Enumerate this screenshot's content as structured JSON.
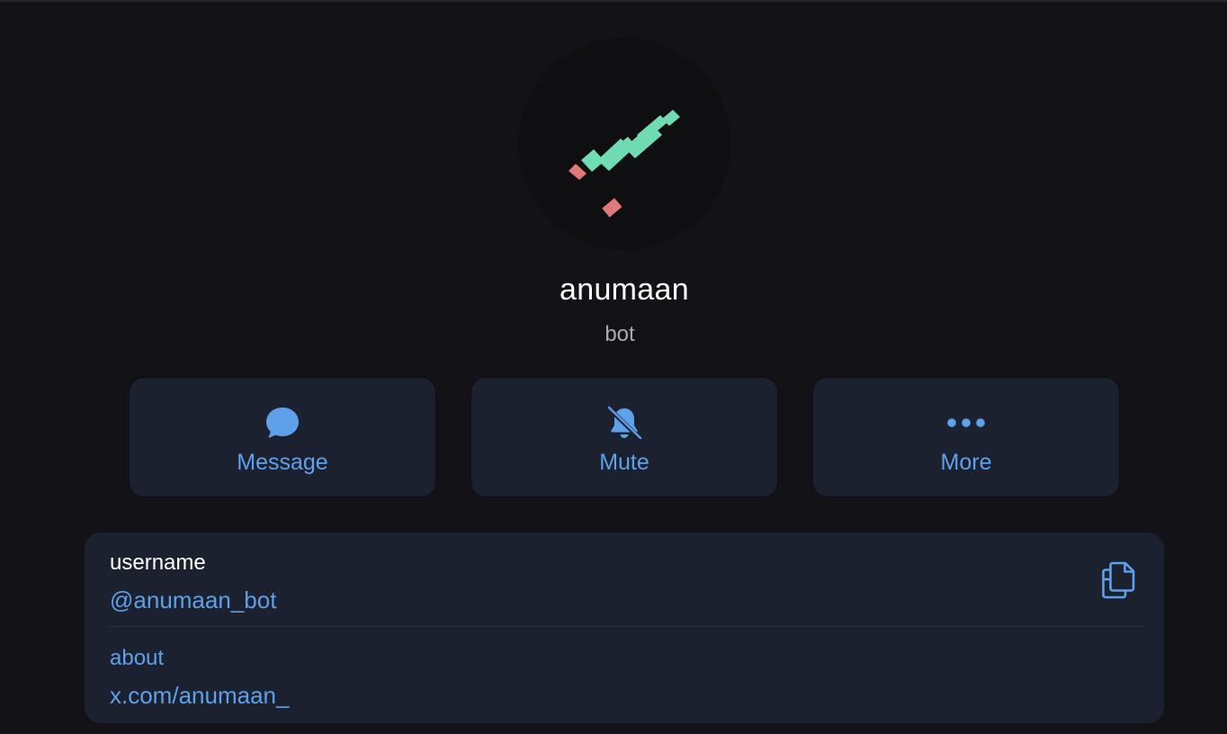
{
  "profile": {
    "name": "anumaan",
    "subtitle": "bot",
    "avatar_icon": "trend-chart-logo",
    "logo_colors": {
      "primary": "#6fdcb4",
      "accent": "#e07a7a"
    }
  },
  "actions": [
    {
      "label": "Message",
      "icon": "chat-bubble-icon"
    },
    {
      "label": "Mute",
      "icon": "bell-slash-icon"
    },
    {
      "label": "More",
      "icon": "ellipsis-icon"
    }
  ],
  "info": {
    "username_label": "username",
    "username_value": "@anumaan_bot",
    "copy_icon": "copy-icon",
    "about_label": "about",
    "about_value": "x.com/anumaan_"
  },
  "colors": {
    "background": "#131317",
    "card": "#1c2130",
    "accent": "#5ea0ea",
    "text": "#ffffff",
    "muted": "#a9abb4"
  }
}
